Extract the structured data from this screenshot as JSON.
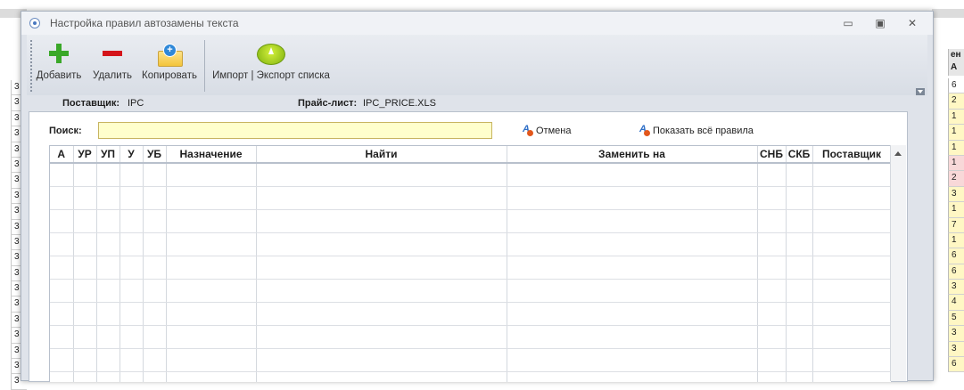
{
  "window": {
    "title": "Настройка правил автозамены текста",
    "controls": {
      "minimize": "▭",
      "maximize": "▣",
      "close": "✕"
    }
  },
  "toolbar": {
    "add_label": "Добавить",
    "delete_label": "Удалить",
    "copy_label": "Копировать",
    "import_export_label": "Импорт | Экспорт списка"
  },
  "info": {
    "supplier_key": "Поставщик:",
    "supplier_value": "IPC",
    "pricelist_key": "Прайс-лист:",
    "pricelist_value": "IPC_PRICE.XLS"
  },
  "search": {
    "label": "Поиск:",
    "value": "",
    "cancel_label": "Отмена",
    "show_all_label": "Показать всё правила"
  },
  "grid": {
    "columns": [
      "А",
      "УР",
      "УП",
      "У",
      "УБ",
      "Назначение",
      "Найти",
      "Заменить на",
      "СНБ",
      "СКБ",
      "Поставщик"
    ],
    "rows": []
  },
  "background": {
    "left_col": [
      "3",
      "3",
      "3",
      "3",
      "3",
      "3",
      "3",
      "3",
      "3",
      "3",
      "3",
      "3",
      "3",
      "3",
      "3",
      "3",
      "3",
      "3",
      "3",
      "3"
    ],
    "right_header": "Ан\nА",
    "right_col": [
      "6",
      "2",
      "1",
      "1",
      "1",
      "1",
      "2",
      "3",
      "1",
      "7",
      "1",
      "6",
      "6",
      "3",
      "4",
      "5",
      "3",
      "3",
      "6"
    ]
  }
}
